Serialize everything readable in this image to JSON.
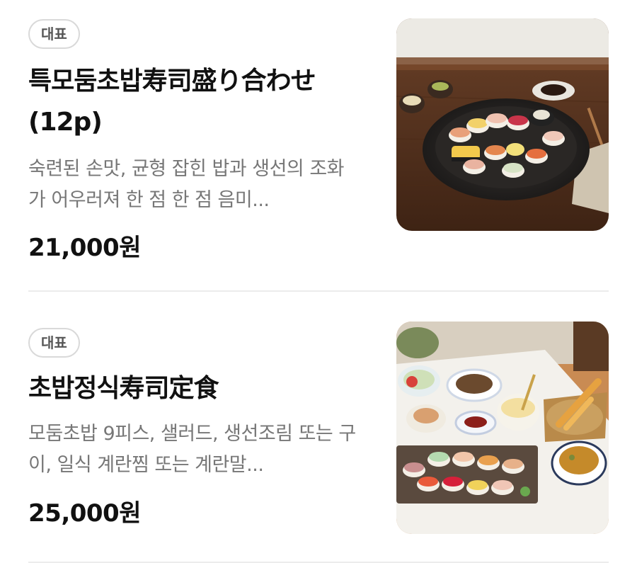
{
  "menu": {
    "items": [
      {
        "badge": "대표",
        "title": "특모둠초밥寿司盛り合わせ(12p)",
        "description": "숙련된 손맛, 균형 잡힌 밥과 생선의 조화가 어우러져 한 점 한 점 음미...",
        "price": "21,000원",
        "image": "sushi-platter-photo"
      },
      {
        "badge": "대표",
        "title": "초밥정식寿司定食",
        "description": "모둠초밥 9피스, 샐러드, 생선조림 또는 구이, 일식 계란찜 또는 계란말...",
        "price": "25,000원",
        "image": "sushi-set-meal-photo"
      }
    ]
  },
  "colors": {
    "title": "#111111",
    "description": "#777777",
    "badge_border": "#d9d9d9",
    "divider": "#ececec"
  }
}
